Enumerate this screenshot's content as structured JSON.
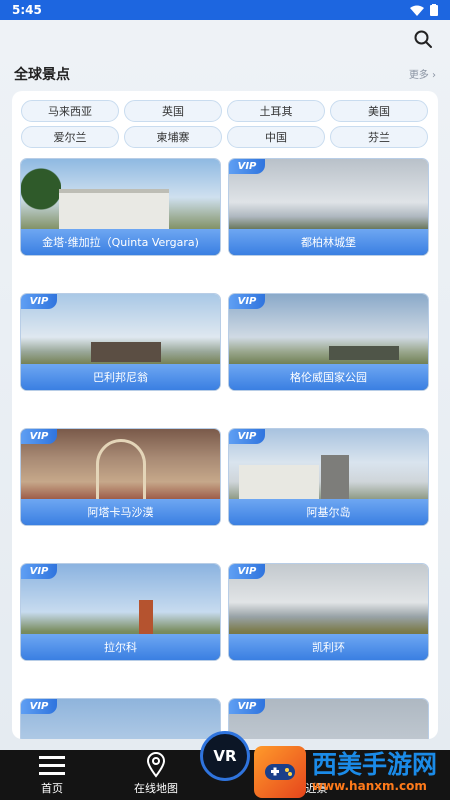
{
  "status": {
    "time": "5:45"
  },
  "header": {
    "section_title": "全球景点",
    "more_label": "更多 ›"
  },
  "tags": [
    "马来西亚",
    "英国",
    "土耳其",
    "美国",
    "爱尔兰",
    "柬埔寨",
    "中国",
    "芬兰"
  ],
  "cards": [
    {
      "title": "金塔·维加拉（Quinta Vergara)",
      "vip": ""
    },
    {
      "title": "都柏林城堡",
      "vip": "VIP"
    },
    {
      "title": "巴利邦尼翁",
      "vip": "VIP"
    },
    {
      "title": "格伦威国家公园",
      "vip": "VIP"
    },
    {
      "title": "阿塔卡马沙漠",
      "vip": "VIP"
    },
    {
      "title": "阿基尔岛",
      "vip": "VIP"
    },
    {
      "title": "拉尔科",
      "vip": "VIP"
    },
    {
      "title": "凯利环",
      "vip": "VIP"
    },
    {
      "title": "",
      "vip": "VIP"
    },
    {
      "title": "",
      "vip": "VIP"
    }
  ],
  "nav": {
    "home": "首页",
    "map": "在线地图",
    "vr": "VR",
    "nearby": "附近景"
  },
  "watermark": {
    "title": "西美手游网",
    "url": "www.hanxm.com"
  },
  "colors": {
    "accent": "#2f74de",
    "statusbar": "#1d66e0",
    "caption": "#3a7fe2"
  },
  "icons": [
    "search-icon",
    "more-chevron-icon",
    "menu-icon",
    "map-pin-icon",
    "wifi-icon",
    "battery-icon",
    "vr-icon"
  ]
}
